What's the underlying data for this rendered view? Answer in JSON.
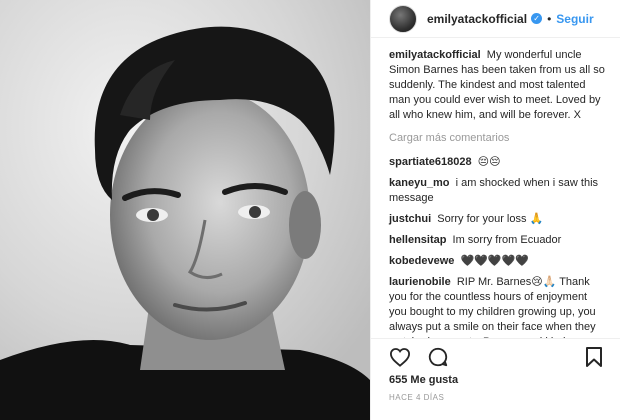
{
  "header": {
    "username": "emilyatackofficial",
    "verified_mark": "✓",
    "separator": "•",
    "follow_label": "Seguir"
  },
  "caption": {
    "username": "emilyatackofficial",
    "text": "My wonderful uncle Simon Barnes has been taken from us all so suddenly. The kindest and most talented man you could ever wish to meet. Loved by all who knew him, and will be forever. X"
  },
  "load_more_label": "Cargar más comentarios",
  "comments": [
    {
      "username": "spartiate618028",
      "text": "😔😔"
    },
    {
      "username": "kaneyu_mo",
      "text": "i am shocked when i saw this message"
    },
    {
      "username": "justchui",
      "text": "Sorry for your loss 🙏"
    },
    {
      "username": "hellensitap",
      "text": "Im sorry from Ecuador"
    },
    {
      "username": "kobedevewe",
      "text": "🖤🖤🖤🖤🖤"
    },
    {
      "username": "laurienobile",
      "text": "RIP Mr. Barnes😢🙏🏻 Thank you for the countless hours of enjoyment you bought to my children growing up, you always put a smile on their face when they watched you on t.v.Prayers and kind thoughts to your family!🙏🏻 you will forever"
    }
  ],
  "actions": {
    "icons": [
      "heart-icon",
      "comment-icon",
      "bookmark-icon"
    ]
  },
  "likes_label": "655 Me gusta",
  "timestamp": "HACE 4 DÍAS",
  "colors": {
    "accent": "#3897f0",
    "text": "#262626",
    "muted": "#999999",
    "border": "#efefef"
  }
}
